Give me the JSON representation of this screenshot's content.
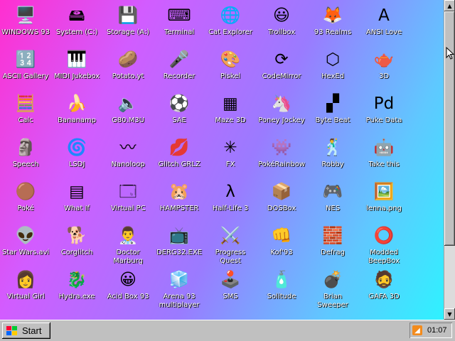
{
  "desktop": {
    "icons": [
      {
        "label": "WINDOWS 93",
        "glyph": "🖥️",
        "icon": "computer-icon"
      },
      {
        "label": "System (C:)",
        "glyph": "🖴",
        "icon": "drive-icon"
      },
      {
        "label": "Storage (A:)",
        "glyph": "💾",
        "icon": "floppy-drive-icon"
      },
      {
        "label": "Terminal",
        "glyph": "⌨",
        "icon": "terminal-icon"
      },
      {
        "label": "Cat Explorer",
        "glyph": "🌐",
        "icon": "globe-icon"
      },
      {
        "label": "Trollbox",
        "glyph": "😃",
        "icon": "smiley-balloon-icon"
      },
      {
        "label": "93 Realms",
        "glyph": "🦊",
        "icon": "fox-icon"
      },
      {
        "label": "ANSI Love",
        "glyph": "A",
        "icon": "ansi-letter-icon"
      },
      {
        "label": "ASCII Gallery",
        "glyph": "🔢",
        "icon": "ascii-numbers-icon"
      },
      {
        "label": "MIDI Jukebox",
        "glyph": "🎹",
        "icon": "piano-keys-icon"
      },
      {
        "label": "Potato.yt",
        "glyph": "🥔",
        "icon": "potato-icon"
      },
      {
        "label": "Recorder",
        "glyph": "🎤",
        "icon": "microphone-icon"
      },
      {
        "label": "Piskel",
        "glyph": "🎨",
        "icon": "palette-icon"
      },
      {
        "label": "CodeMirror",
        "glyph": "⟳",
        "icon": "codemirror-icon"
      },
      {
        "label": "HexEd",
        "glyph": "⬡",
        "icon": "hexagon-cube-icon"
      },
      {
        "label": "3D",
        "glyph": "🫖",
        "icon": "teapot-icon"
      },
      {
        "label": "Calc",
        "glyph": "🧮",
        "icon": "calculator-icon"
      },
      {
        "label": "Bananamp",
        "glyph": "🍌",
        "icon": "banana-icon"
      },
      {
        "label": "G80.M3U",
        "glyph": "🔈",
        "icon": "playlist-file-icon"
      },
      {
        "label": "SAE",
        "glyph": "⚽",
        "icon": "checkered-ball-icon"
      },
      {
        "label": "Maze 3D",
        "glyph": "▦",
        "icon": "maze-icon"
      },
      {
        "label": "Poney Jockey",
        "glyph": "🦄",
        "icon": "pony-icon"
      },
      {
        "label": "Byte Beat",
        "glyph": "▞",
        "icon": "bytebeat-icon"
      },
      {
        "label": "Puke Data",
        "glyph": "Pd",
        "icon": "pure-data-icon"
      },
      {
        "label": "Speech",
        "glyph": "🗿",
        "icon": "speech-face-icon"
      },
      {
        "label": "LSDJ",
        "glyph": "🌀",
        "icon": "lsdj-icon"
      },
      {
        "label": "Nanoloop",
        "glyph": "〰",
        "icon": "wave-icon"
      },
      {
        "label": "Glitch GRLZ",
        "glyph": "💋",
        "icon": "lips-icon"
      },
      {
        "label": "FX",
        "glyph": "✳",
        "icon": "atom-icon"
      },
      {
        "label": "PokéRainbow",
        "glyph": "👾",
        "icon": "pokemon-icon"
      },
      {
        "label": "Robby",
        "glyph": "🕺",
        "icon": "stick-figure-icon"
      },
      {
        "label": "Take this",
        "glyph": "🤖",
        "icon": "take-this-icon"
      },
      {
        "label": "Poké",
        "glyph": "🟤",
        "icon": "poke-icon"
      },
      {
        "label": "What If",
        "glyph": "▤",
        "icon": "what-if-icon"
      },
      {
        "label": "Virtual PC",
        "glyph": "🗔",
        "icon": "virtual-pc-icon"
      },
      {
        "label": "HAMPSTER",
        "glyph": "🐹",
        "icon": "hamster-icon"
      },
      {
        "label": "Half-Life 3",
        "glyph": "λ",
        "icon": "half-life-icon"
      },
      {
        "label": "DOSBox",
        "glyph": "📦",
        "icon": "dosbox-icon"
      },
      {
        "label": "NES",
        "glyph": "🎮",
        "icon": "nes-icon"
      },
      {
        "label": "lenna.png",
        "glyph": "🖼️",
        "icon": "image-file-icon"
      },
      {
        "label": "Star Wars.avi",
        "glyph": "👽",
        "icon": "yoda-icon"
      },
      {
        "label": "Corglitch",
        "glyph": "🐕",
        "icon": "corgi-icon"
      },
      {
        "label": "Doctor Marburg",
        "glyph": "👨‍⚕️",
        "icon": "doctor-icon"
      },
      {
        "label": "DERG32.EXE",
        "glyph": "📺",
        "icon": "derg-monitor-icon"
      },
      {
        "label": "Progress Quest",
        "glyph": "⚔️",
        "icon": "crossed-swords-icon"
      },
      {
        "label": "Kof'93",
        "glyph": "👊",
        "icon": "fighter-icon"
      },
      {
        "label": "Defrag",
        "glyph": "🧱",
        "icon": "defrag-icon"
      },
      {
        "label": "Modded BeepBox",
        "glyph": "⭕",
        "icon": "green-ring-icon"
      },
      {
        "label": "Virtual Girl",
        "glyph": "👩",
        "icon": "virtual-girl-icon"
      },
      {
        "label": "Hydra.exe",
        "glyph": "🐉",
        "icon": "dragon-icon"
      },
      {
        "label": "Acid Box 93",
        "glyph": "😀",
        "icon": "acid-smiley-icon"
      },
      {
        "label": "Arena 93 multiplayer",
        "glyph": "🧊",
        "icon": "cube-icon"
      },
      {
        "label": "SMS",
        "glyph": "🕹️",
        "icon": "console-icon"
      },
      {
        "label": "Solitude",
        "glyph": "🧴",
        "icon": "bottle-icon"
      },
      {
        "label": "Brian Sweeper",
        "glyph": "💣",
        "icon": "mine-icon"
      },
      {
        "label": "GAFA 3D",
        "glyph": "🧔",
        "icon": "gafa-face-icon"
      }
    ]
  },
  "taskbar": {
    "start_label": "Start",
    "clock": "01:07"
  }
}
